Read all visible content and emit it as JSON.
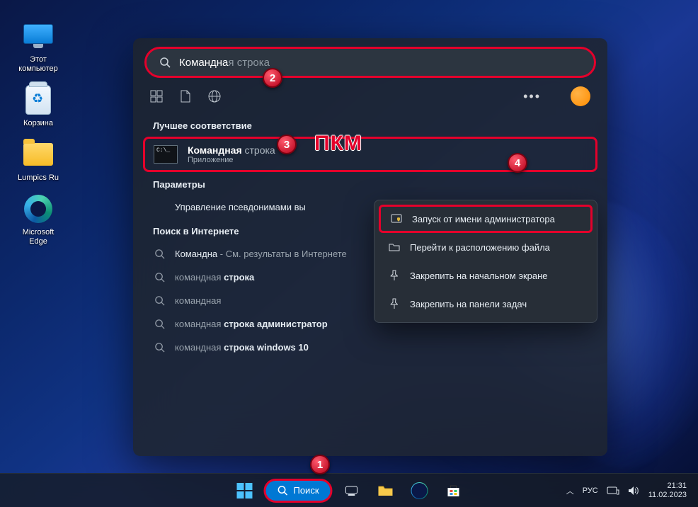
{
  "desktop": {
    "icons": [
      {
        "id": "this-pc",
        "label": "Этот\nкомпьютер"
      },
      {
        "id": "recycle",
        "label": "Корзина"
      },
      {
        "id": "folder",
        "label": "Lumpics Ru"
      },
      {
        "id": "edge",
        "label": "Microsoft\nEdge"
      }
    ]
  },
  "search": {
    "query_typed": "Командна",
    "query_ghost": "я строка",
    "best_match_heading": "Лучшее соответствие",
    "best_match_title_bold": "Командная",
    "best_match_title_rest": " строка",
    "best_match_subtitle": "Приложение",
    "settings_heading": "Параметры",
    "settings_item": "Управление псевдонимами вы",
    "web_heading": "Поиск в Интернете",
    "web_items": [
      {
        "prefix": "Командна",
        "rest": " - См. результаты в Интернете"
      },
      {
        "prefix": "командная",
        "rest": " строка"
      },
      {
        "prefix": "командная",
        "rest": ""
      },
      {
        "prefix": "командная",
        "rest": " строка администратор"
      },
      {
        "prefix": "командная",
        "rest": " строка windows 10"
      }
    ]
  },
  "context_menu": [
    {
      "id": "run-admin",
      "label": "Запуск от имени администратора",
      "hl": true
    },
    {
      "id": "open-location",
      "label": "Перейти к расположению файла",
      "hl": false
    },
    {
      "id": "pin-start",
      "label": "Закрепить на начальном экране",
      "hl": false
    },
    {
      "id": "pin-taskbar",
      "label": "Закрепить на панели задач",
      "hl": false
    }
  ],
  "annotations": {
    "markers": {
      "1": "1",
      "2": "2",
      "3": "3",
      "4": "4"
    },
    "rmb_hint": "ПКМ"
  },
  "taskbar": {
    "search_label": "Поиск",
    "lang": "РУС",
    "time": "21:31",
    "date": "11.02.2023"
  },
  "colors": {
    "highlight": "#e4002b",
    "accent": "#0078d4"
  }
}
